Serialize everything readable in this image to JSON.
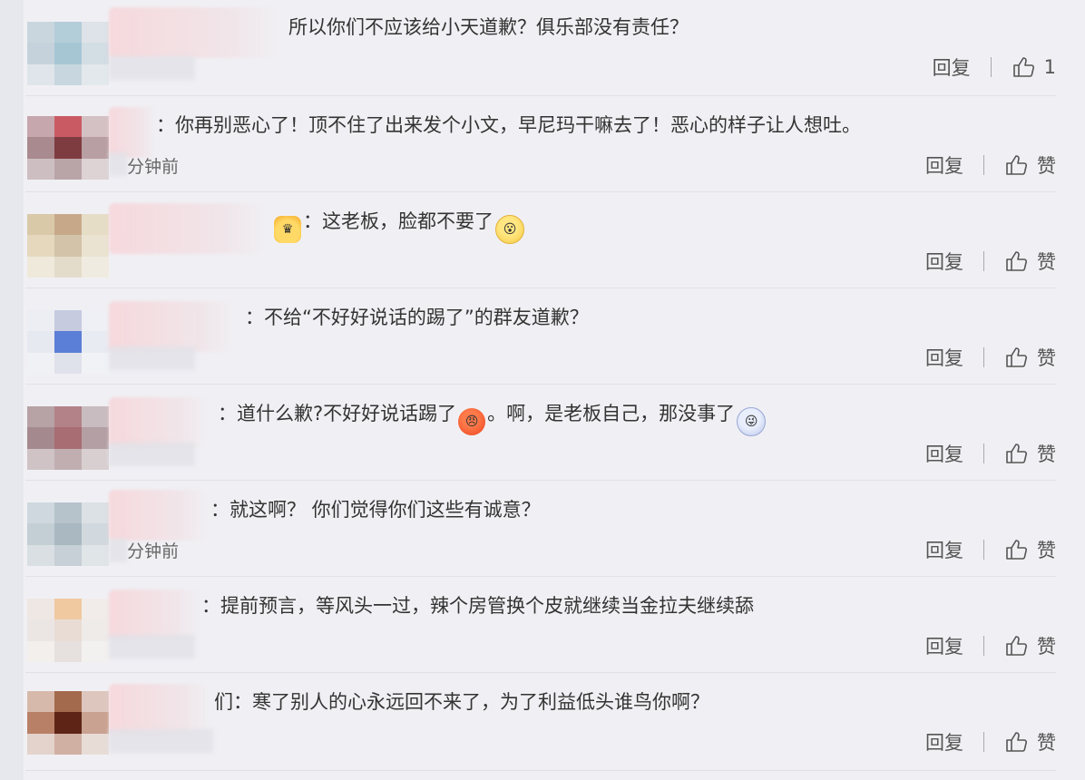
{
  "comments": [
    {
      "text": "所以你们不应该给小天道歉？俱乐部没有责任？",
      "name_suffix": "",
      "reply_label": "回复",
      "like_label": "1",
      "emojis": []
    },
    {
      "text": "你再别恶心了！顶不住了出来发个小文，早尼玛干嘛去了！恶心的样子让人想吐。",
      "name_suffix": "：",
      "time_text": "分钟前",
      "reply_label": "回复",
      "like_label": "赞",
      "emojis": []
    },
    {
      "text": "这老板，脸都不要了",
      "name_suffix": "：",
      "reply_label": "回复",
      "like_label": "赞",
      "emojis": [
        "crown-emoji",
        "shocked-face-emoji"
      ]
    },
    {
      "text": "不给“不好好说话的踢了”的群友道歉？",
      "name_suffix": "：",
      "reply_label": "回复",
      "like_label": "赞",
      "emojis": []
    },
    {
      "text_before": "道什么歉?不好好说话踢了",
      "text_middle": "。啊，是老板自己，那没事了",
      "name_suffix": "：",
      "reply_label": "回复",
      "like_label": "赞",
      "emojis": [
        "angry-face-emoji",
        "ghost-face-emoji"
      ]
    },
    {
      "text": "就这啊？ 你们觉得你们这些有诚意？",
      "name_suffix": "：",
      "time_text": "分钟前",
      "reply_label": "回复",
      "like_label": "赞",
      "emojis": []
    },
    {
      "text": "提前预言，等风头一过，辣个房管换个皮就继续当金拉夫继续舔",
      "name_suffix": "：",
      "reply_label": "回复",
      "like_label": "赞",
      "emojis": []
    },
    {
      "text": "寒了别人的心永远回不来了，为了利益低头谁鸟你啊？",
      "name_suffix": "们：",
      "reply_label": "回复",
      "like_label": "赞",
      "emojis": []
    }
  ]
}
